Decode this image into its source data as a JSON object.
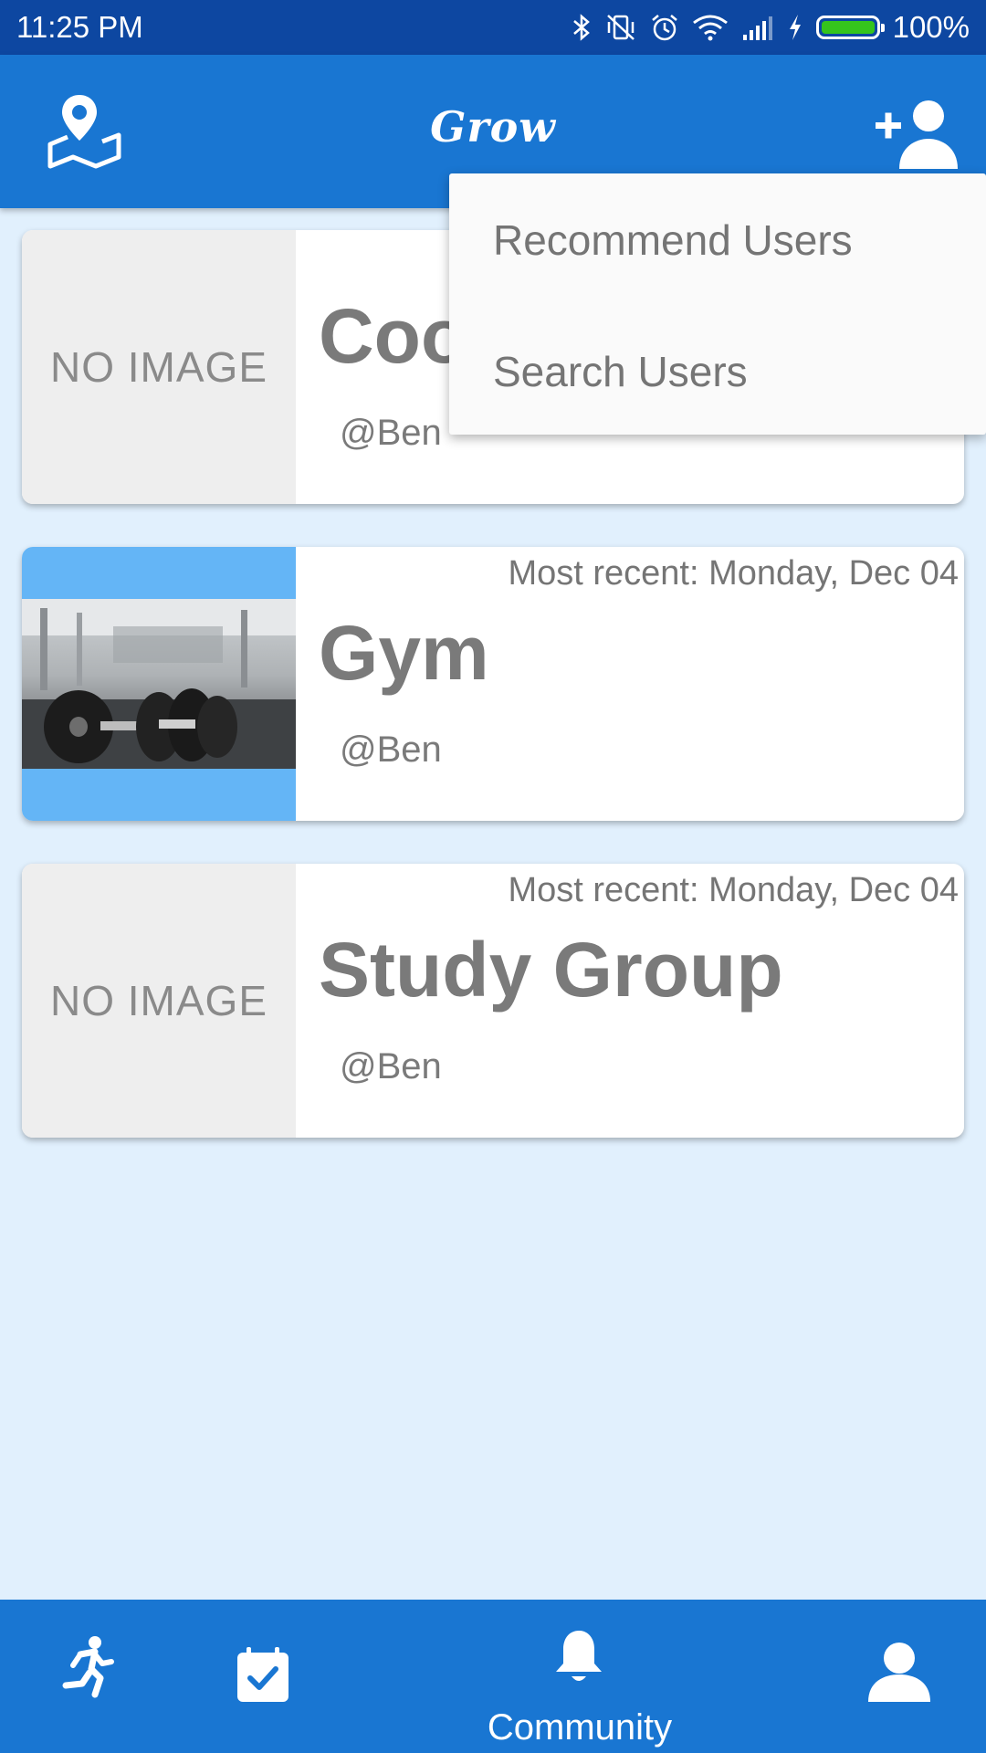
{
  "status_bar": {
    "time": "11:25 PM",
    "battery_text": "100%",
    "battery_level": 1.0,
    "icons": [
      "bluetooth-icon",
      "vibrate-off-icon",
      "alarm-icon",
      "wifi-icon",
      "signal-icon",
      "charging-icon",
      "battery-icon"
    ]
  },
  "app_bar": {
    "title": "Grow",
    "left_icon": "map-pin-icon",
    "right_icon": "add-user-icon"
  },
  "popup_menu": {
    "items": [
      {
        "label": "Recommend Users"
      },
      {
        "label": "Search Users"
      }
    ]
  },
  "groups": [
    {
      "title": "Coo",
      "owner": "@Ben",
      "recent": "",
      "thumbnail": "NO IMAGE"
    },
    {
      "title": "Gym",
      "owner": "@Ben",
      "recent": "Most recent: Monday, Dec 04",
      "thumbnail": "dumbbells-photo"
    },
    {
      "title": "Study Group",
      "owner": "@Ben",
      "recent": "Most recent: Monday, Dec 04",
      "thumbnail": "NO IMAGE"
    }
  ],
  "bottom_nav": {
    "items": [
      {
        "icon": "running-icon",
        "label": ""
      },
      {
        "icon": "calendar-check-icon",
        "label": ""
      },
      {
        "icon": "bell-icon",
        "label": "Community",
        "active": true
      },
      {
        "icon": "person-icon",
        "label": ""
      }
    ]
  },
  "colors": {
    "primary": "#1976d2",
    "status_bar": "#0d47a1",
    "background": "#e1f0fd",
    "thumb_accent": "#64b5f6",
    "text_gray": "#7a7a7a"
  }
}
